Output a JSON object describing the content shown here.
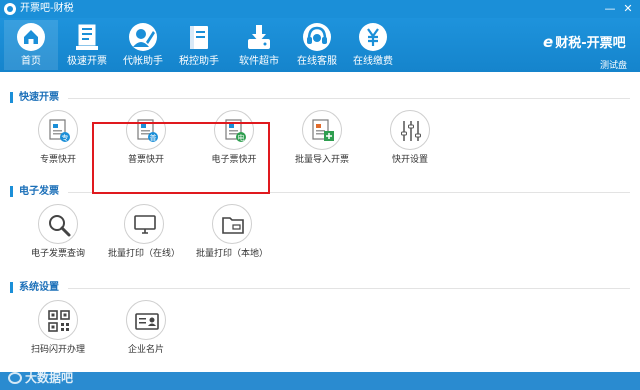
{
  "window": {
    "title": "开票吧-财税",
    "controls": {
      "minimize": "—",
      "close": "✕"
    }
  },
  "toolbar": {
    "items": [
      {
        "label": "首页",
        "icon": "home-icon"
      },
      {
        "label": "极速开票",
        "icon": "invoice-icon"
      },
      {
        "label": "代帐助手",
        "icon": "accountant-icon"
      },
      {
        "label": "税控助手",
        "icon": "tax-book-icon"
      },
      {
        "label": "软件超市",
        "icon": "download-icon"
      },
      {
        "label": "在线客服",
        "icon": "headset-icon"
      },
      {
        "label": "在线缴费",
        "icon": "yen-icon"
      }
    ],
    "brand": "财税-开票吧",
    "brand_mark": "e",
    "account_label": "测试盘"
  },
  "sections": {
    "quick_invoice": {
      "title": "快速开票",
      "tiles": [
        {
          "label": "专票快开",
          "icon": "special-invoice-icon"
        },
        {
          "label": "普票快开",
          "icon": "general-invoice-icon"
        },
        {
          "label": "电子票快开",
          "icon": "e-invoice-icon"
        },
        {
          "label": "批量导入开票",
          "icon": "batch-import-icon"
        },
        {
          "label": "快开设置",
          "icon": "sliders-icon"
        }
      ]
    },
    "e_invoice": {
      "title": "电子发票",
      "tiles": [
        {
          "label": "电子发票查询",
          "icon": "magnifier-icon"
        },
        {
          "label": "批量打印（在线）",
          "icon": "monitor-icon"
        },
        {
          "label": "批量打印（本地）",
          "icon": "folder-icon"
        }
      ]
    },
    "settings": {
      "title": "系统设置",
      "tiles": [
        {
          "label": "扫码闪开办理",
          "icon": "qr-code-icon"
        },
        {
          "label": "企业名片",
          "icon": "business-card-icon"
        }
      ]
    }
  },
  "watermark": "大数据吧",
  "colors": {
    "primary": "#1b8fd8",
    "highlight": "#e0191e",
    "badge_green": "#2e9e4f"
  }
}
